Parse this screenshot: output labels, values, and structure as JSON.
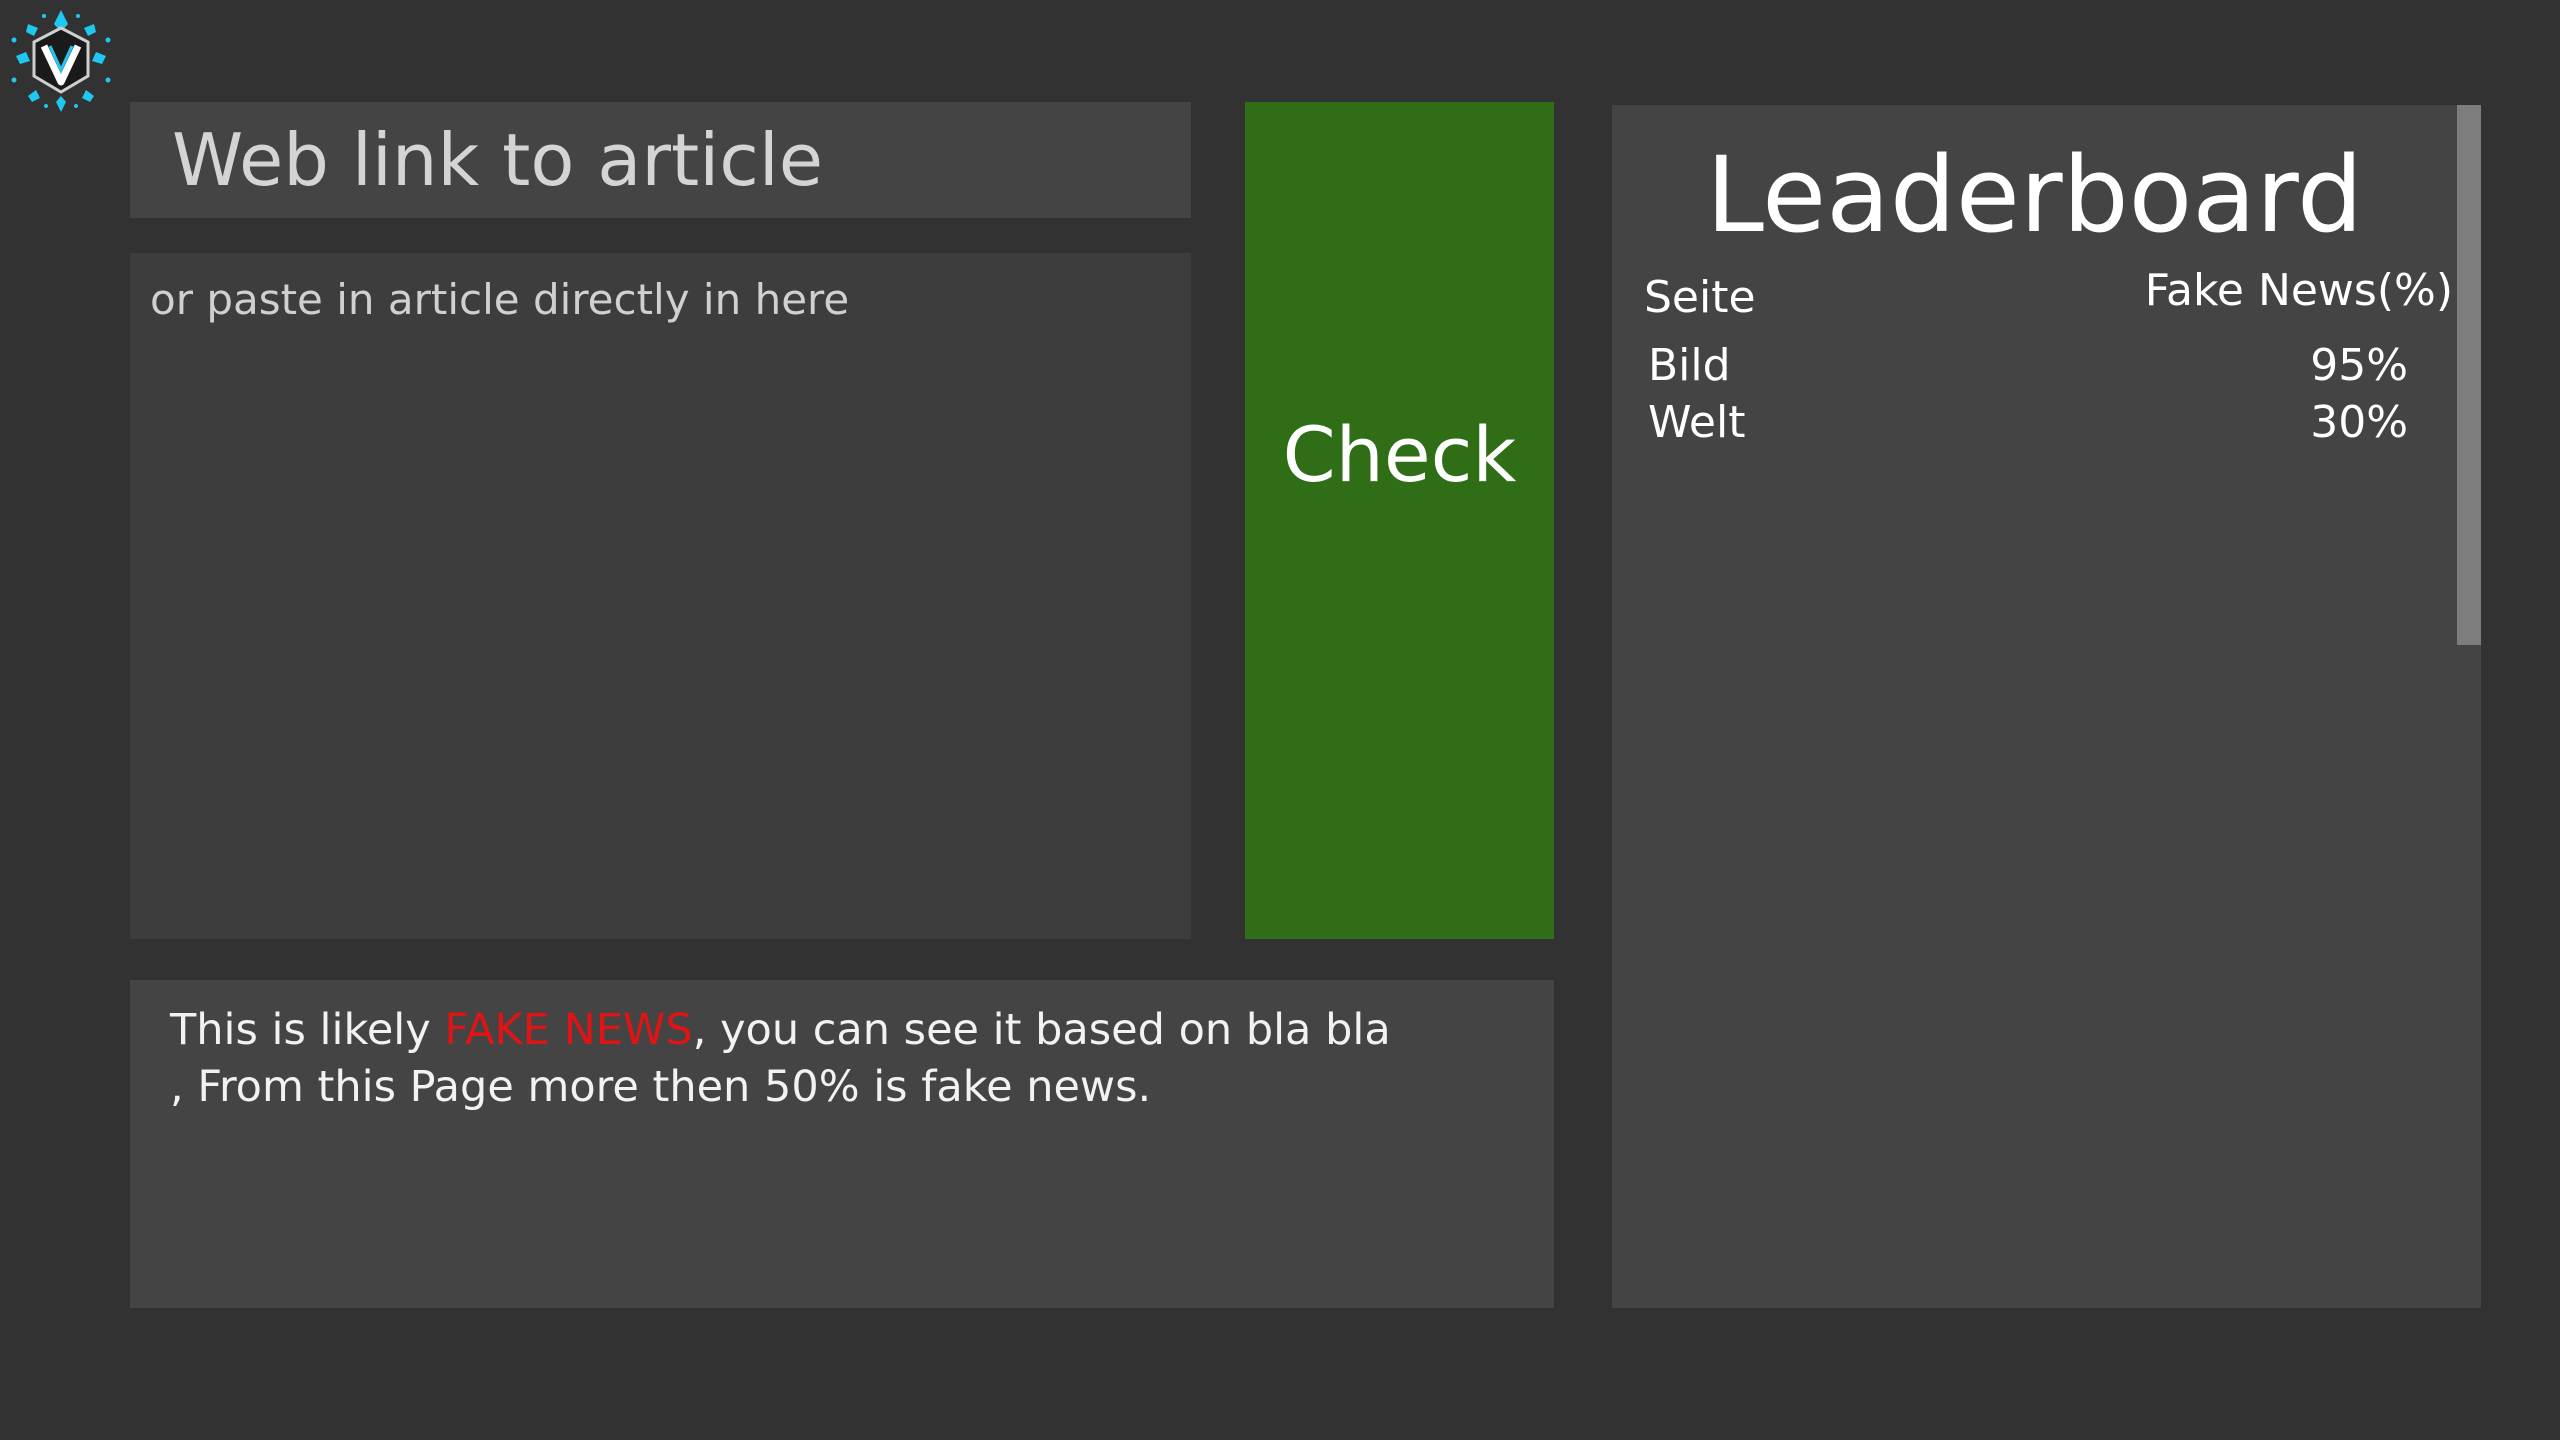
{
  "url_input": {
    "placeholder": "Web link to article"
  },
  "article_input": {
    "placeholder": "or paste in article directly in here"
  },
  "check_button": {
    "label": "Check"
  },
  "result": {
    "prefix": "This is likely ",
    "highlight": "FAKE NEWS",
    "suffix": ", you can see it based on bla bla",
    "line2": ", From this Page more then 50% is fake news.",
    "highlight_color": "#e01414"
  },
  "leaderboard": {
    "title": "Leaderboard",
    "col_site": "Seite",
    "col_pct": "Fake News(%)",
    "rows": [
      {
        "site": "Bild",
        "pct": "95%"
      },
      {
        "site": "Welt",
        "pct": "30%"
      }
    ]
  },
  "colors": {
    "background": "#323232",
    "panel": "#444444",
    "check_button": "#2f6e16",
    "logo_accent": "#1fc8f0"
  },
  "icons": {
    "logo": "v-shield-logo-icon"
  }
}
